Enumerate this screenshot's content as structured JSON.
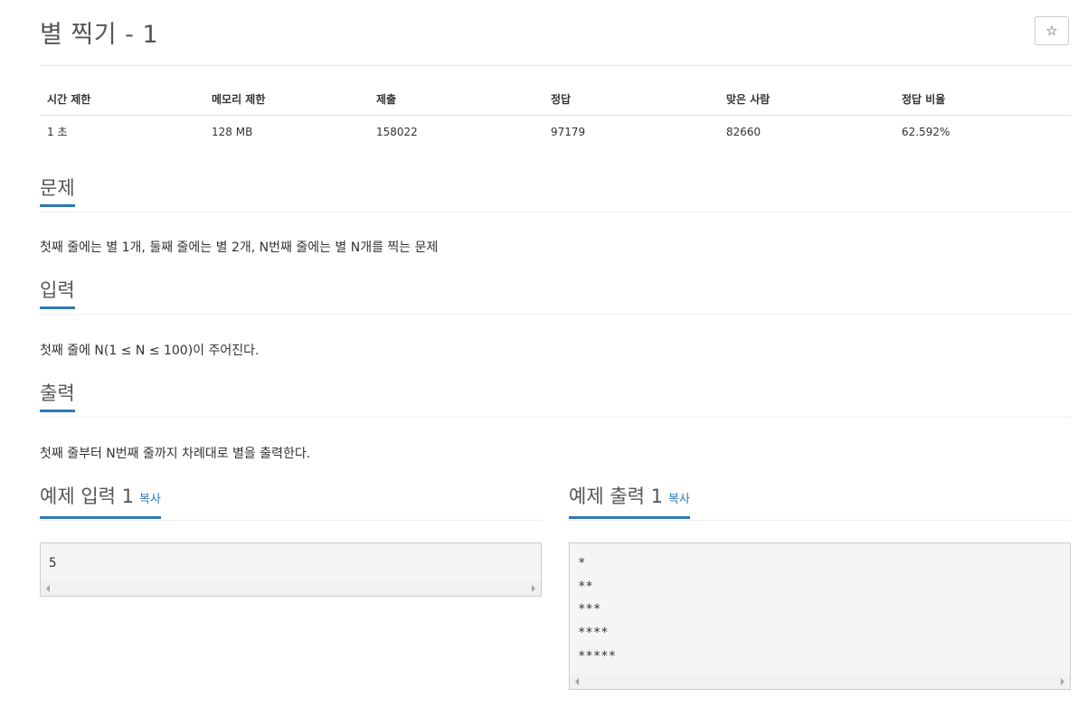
{
  "problem": {
    "title": "별 찍기 - 1",
    "star_icon": "☆"
  },
  "info_table": {
    "headers": [
      "시간 제한",
      "메모리 제한",
      "제출",
      "정답",
      "맞은 사람",
      "정답 비율"
    ],
    "values": [
      "1 초",
      "128 MB",
      "158022",
      "97179",
      "82660",
      "62.592%"
    ]
  },
  "sections": {
    "description": {
      "heading": "문제",
      "text": "첫째 줄에는 별 1개, 둘째 줄에는 별 2개, N번째 줄에는 별 N개를 찍는 문제"
    },
    "input": {
      "heading": "입력",
      "text": "첫째 줄에 N(1 ≤ N ≤ 100)이 주어진다."
    },
    "output": {
      "heading": "출력",
      "text": "첫째 줄부터 N번째 줄까지 차례대로 별을 출력한다."
    }
  },
  "samples": {
    "input": {
      "heading": "예제 입력 1",
      "copy_label": "복사",
      "lines": [
        "5"
      ]
    },
    "output": {
      "heading": "예제 출력 1",
      "copy_label": "복사",
      "lines": [
        "*",
        "**",
        "***",
        "****",
        "*****"
      ]
    }
  },
  "colors": {
    "accent": "#2e78b7",
    "heading_text": "#555555",
    "sample_bg": "#f5f5f5"
  }
}
